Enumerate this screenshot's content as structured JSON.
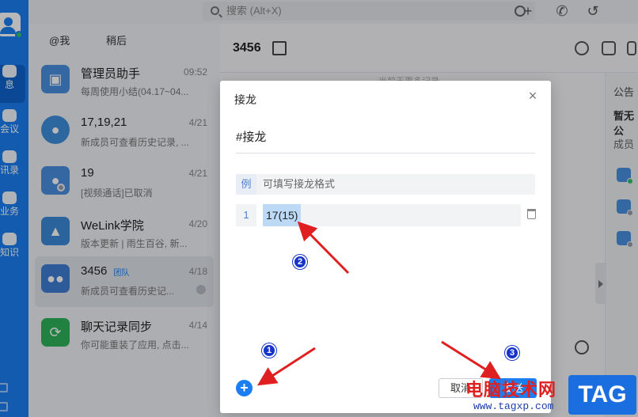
{
  "rail": {
    "items": [
      {
        "label": "消息",
        "icon": "message-icon"
      },
      {
        "label": "会议",
        "icon": "video-icon"
      },
      {
        "label": "通讯录",
        "icon": "contacts-icon"
      },
      {
        "label": "业务",
        "icon": "apps-icon"
      },
      {
        "label": "知识",
        "icon": "book-icon"
      }
    ],
    "items_visible": [
      "息",
      "会议",
      "讯录",
      "业务",
      "知识"
    ]
  },
  "search": {
    "placeholder": "搜索 (Alt+X)"
  },
  "list": {
    "tabs": [
      "@我",
      "稍后"
    ],
    "conversations": [
      {
        "name": "管理员助手",
        "time": "09:52",
        "preview": "每周使用小结(04.17~04..."
      },
      {
        "name": "17,19,21",
        "time": "4/21",
        "preview": "新成员可查看历史记录, ..."
      },
      {
        "name": "19",
        "time": "4/21",
        "preview": "[视频通话]已取消"
      },
      {
        "name": "WeLink学院",
        "time": "4/20",
        "preview": "版本更新 | 雨生百谷, 新..."
      },
      {
        "name": "3456",
        "badge": "团队",
        "time": "4/18",
        "preview": "新成员可查看历史记..."
      },
      {
        "name": "聊天记录同步",
        "time": "4/14",
        "preview": "你可能重装了应用, 点击..."
      }
    ]
  },
  "chat": {
    "title": "3456",
    "hint": "当前无更多记录",
    "side": {
      "notice": "公告",
      "notice_text": "暂无公",
      "members": "成员"
    }
  },
  "dialog": {
    "title": "接龙",
    "topic": "#接龙",
    "example": {
      "num": "例",
      "text": "可填写接龙格式"
    },
    "entry": {
      "num": "1",
      "value": "17(15)"
    },
    "cancel": "取消",
    "send": "发送"
  },
  "annotations": {
    "step1": "1",
    "step2": "2",
    "step3": "3"
  },
  "watermark": {
    "site": "电脑技术网",
    "url": "www.tagxp.com",
    "tag": "TAG"
  },
  "colors": {
    "accent": "#1b7ef2",
    "arrow": "#e02020"
  }
}
